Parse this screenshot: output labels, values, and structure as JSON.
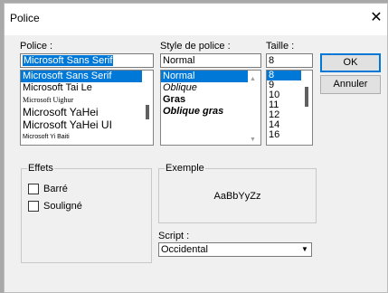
{
  "window": {
    "title": "Police",
    "close_glyph": "✕"
  },
  "font": {
    "label": "Police :",
    "value": "Microsoft Sans Serif",
    "items": [
      {
        "label": "Microsoft Sans Serif",
        "selected": true
      },
      {
        "label": "Microsoft Tai Le"
      },
      {
        "label": "Microsoft Uighur"
      },
      {
        "label": "Microsoft YaHei"
      },
      {
        "label": "Microsoft YaHei UI"
      },
      {
        "label": "Microsoft Yi Baiti"
      }
    ]
  },
  "style": {
    "label": "Style de police :",
    "value": "Normal",
    "items": [
      {
        "label": "Normal",
        "selected": true
      },
      {
        "label": "Oblique"
      },
      {
        "label": "Gras"
      },
      {
        "label": "Oblique gras"
      }
    ]
  },
  "size": {
    "label": "Taille :",
    "value": "8",
    "items": [
      {
        "label": "8",
        "selected": true
      },
      {
        "label": "9"
      },
      {
        "label": "10"
      },
      {
        "label": "11"
      },
      {
        "label": "12"
      },
      {
        "label": "14"
      },
      {
        "label": "16"
      }
    ]
  },
  "buttons": {
    "ok": "OK",
    "cancel": "Annuler"
  },
  "effects": {
    "title": "Effets",
    "strikeout": "Barré",
    "underline": "Souligné"
  },
  "sample": {
    "title": "Exemple",
    "text": "AaBbYyZz"
  },
  "script": {
    "label": "Script :",
    "value": "Occidental"
  }
}
